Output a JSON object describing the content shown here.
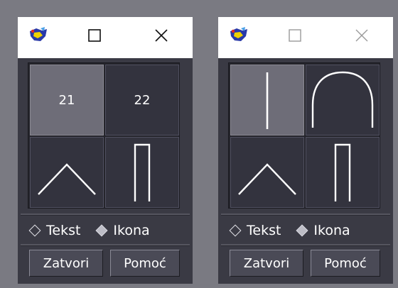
{
  "windows": [
    {
      "grid": {
        "top_left_label": "21",
        "top_right_label": "22",
        "bottom_left_icon": "caret-up-icon",
        "bottom_right_icon": "inverted-u-narrow-icon"
      },
      "radio": {
        "text_label": "Tekst",
        "icon_label": "Ikona",
        "selected": "Ikona"
      },
      "buttons": {
        "close_label": "Zatvori",
        "help_label": "Pomoć"
      },
      "titlebar_state": "active"
    },
    {
      "grid": {
        "top_left_icon": "vertical-line-icon",
        "top_right_icon": "arch-icon",
        "bottom_left_icon": "caret-up-icon",
        "bottom_right_icon": "inverted-u-narrow-icon"
      },
      "radio": {
        "text_label": "Tekst",
        "icon_label": "Ikona",
        "selected": "Ikona"
      },
      "buttons": {
        "close_label": "Zatvori",
        "help_label": "Pomoć"
      },
      "titlebar_state": "inactive"
    }
  ],
  "colors": {
    "desktop": "#7a7a82",
    "window_bg": "#3a3a44",
    "cell_bg": "#33333e",
    "cell_selected": "#6e6d78",
    "text": "#ffffff"
  }
}
